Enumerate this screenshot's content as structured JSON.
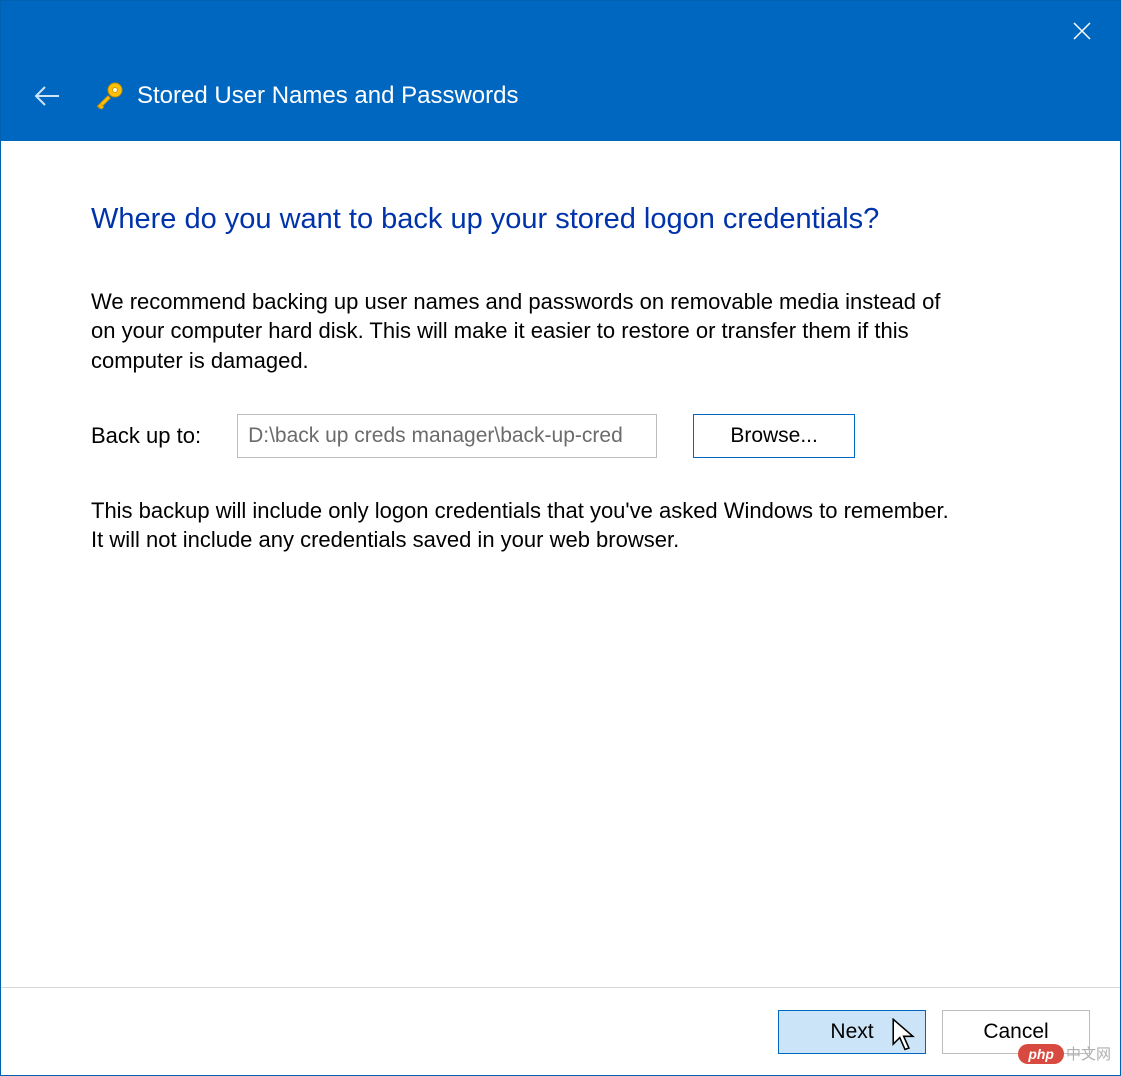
{
  "titlebar": {
    "title": "Stored User Names and Passwords"
  },
  "content": {
    "heading": "Where do you want to back up your stored logon credentials?",
    "description": "We recommend backing up user names and passwords on removable media instead of on your computer hard disk. This will make it easier to restore or transfer them if this computer is damaged.",
    "backup_label": "Back up to:",
    "path_value": "D:\\back up creds manager\\back-up-cred",
    "browse_label": "Browse...",
    "note": "This backup will include only logon credentials that you've asked Windows to remember. It will not include any credentials saved in your web browser."
  },
  "footer": {
    "next_label": "Next",
    "cancel_label": "Cancel"
  },
  "watermark": {
    "badge": "php",
    "text": "中文网"
  }
}
